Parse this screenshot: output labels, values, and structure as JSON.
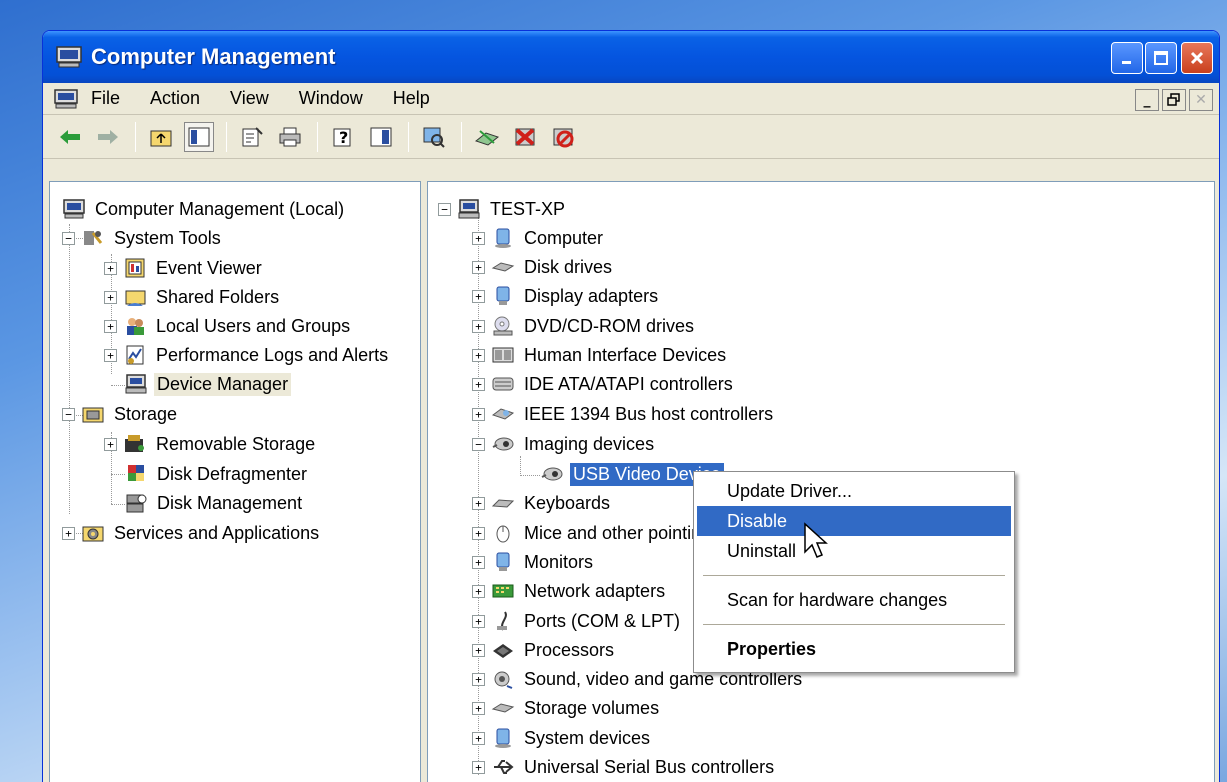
{
  "window": {
    "title": "Computer Management"
  },
  "menu": {
    "items": [
      "File",
      "Action",
      "View",
      "Window",
      "Help"
    ]
  },
  "left_tree": {
    "root": "Computer Management (Local)",
    "system_tools": "System Tools",
    "event_viewer": "Event Viewer",
    "shared_folders": "Shared Folders",
    "local_users": "Local Users and Groups",
    "perf_logs": "Performance Logs and Alerts",
    "device_manager": "Device Manager",
    "storage": "Storage",
    "removable_storage": "Removable Storage",
    "disk_defrag": "Disk Defragmenter",
    "disk_mgmt": "Disk Management",
    "services_apps": "Services and Applications"
  },
  "right_tree": {
    "root": "TEST-XP",
    "categories": [
      "Computer",
      "Disk drives",
      "Display adapters",
      "DVD/CD-ROM drives",
      "Human Interface Devices",
      "IDE ATA/ATAPI controllers",
      "IEEE 1394 Bus host controllers",
      "Imaging devices",
      "Keyboards",
      "Mice and other pointing devices",
      "Monitors",
      "Network adapters",
      "Ports (COM & LPT)",
      "Processors",
      "Sound, video and game controllers",
      "Storage volumes",
      "System devices",
      "Universal Serial Bus controllers"
    ],
    "selected_device": "USB Video Device"
  },
  "context_menu": {
    "update_driver": "Update Driver...",
    "disable": "Disable",
    "uninstall": "Uninstall",
    "scan": "Scan for hardware changes",
    "properties": "Properties"
  },
  "colors": {
    "selection": "#316ac5",
    "titlebar": "#0555e0",
    "window_bg": "#ece9d8"
  }
}
